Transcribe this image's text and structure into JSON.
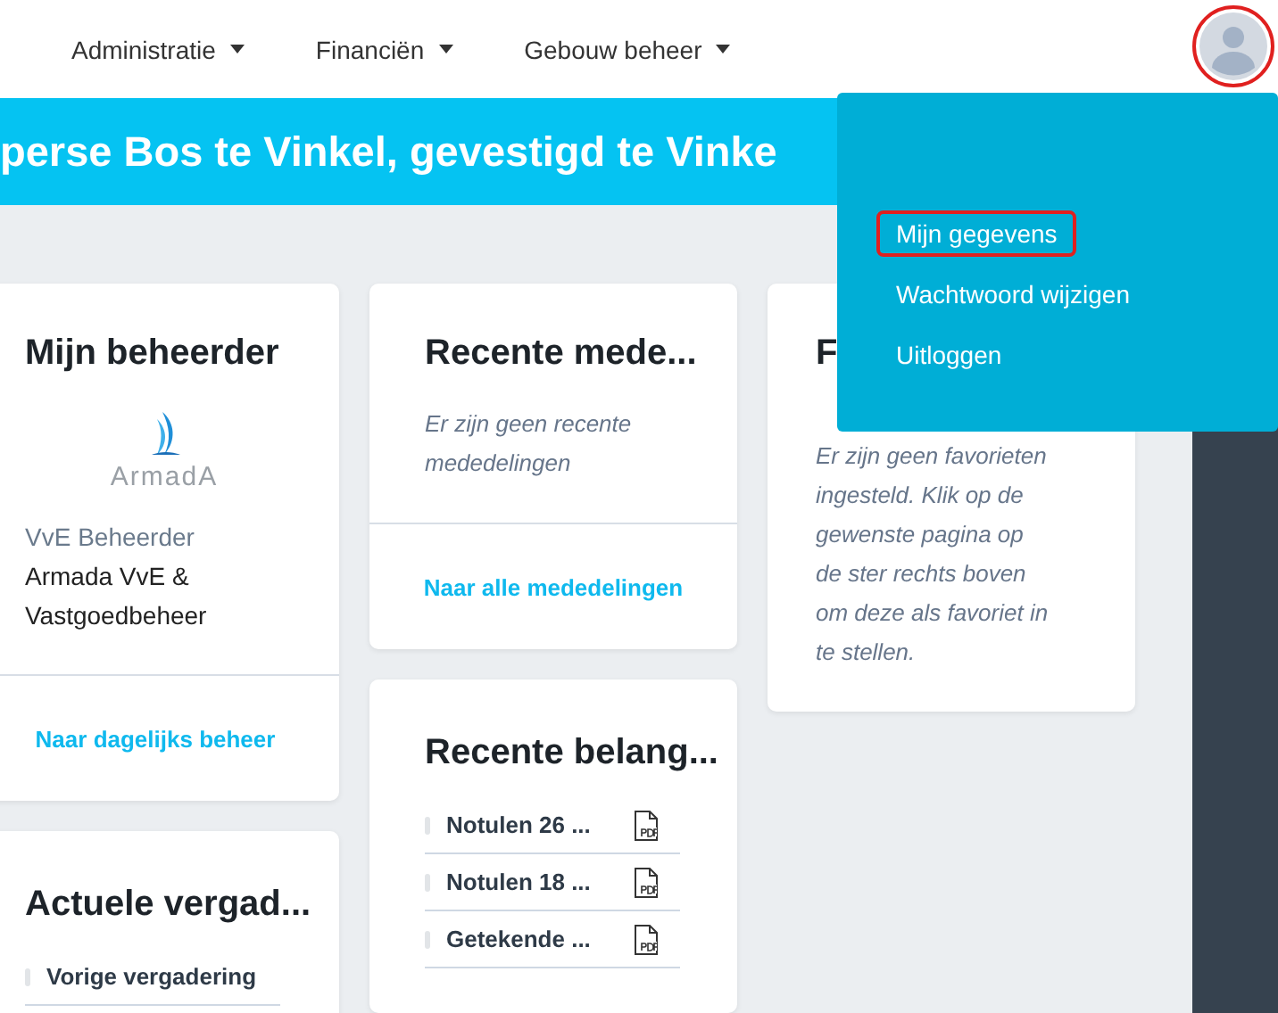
{
  "nav": {
    "items": [
      {
        "label": "Administratie"
      },
      {
        "label": "Financiën"
      },
      {
        "label": "Gebouw beheer"
      }
    ],
    "avatar": {
      "highlighted": true
    }
  },
  "banner": {
    "title": "perse Bos te Vinkel, gevestigd te Vinke"
  },
  "user_menu": {
    "items": [
      {
        "label": "Mijn gegevens",
        "highlighted": true
      },
      {
        "label": "Wachtwoord wijzigen",
        "highlighted": false
      },
      {
        "label": "Uitloggen",
        "highlighted": false
      }
    ]
  },
  "columns": [
    [
      {
        "kind": "manager",
        "title": "Mijn beheerder",
        "logo_text": "ArmadA",
        "role": "VvE Beheerder",
        "name": "Armada VvE & Vastgoedbeheer",
        "link": "Naar dagelijks beheer"
      },
      {
        "kind": "list",
        "title": "Actuele vergad...",
        "items": [
          {
            "label": "Vorige vergadering",
            "pdf": false
          }
        ]
      }
    ],
    [
      {
        "kind": "note",
        "title": "Recente mede...",
        "text": "Er zijn geen recente mededelingen",
        "link": "Naar alle mededelingen"
      },
      {
        "kind": "list",
        "title": "Recente belang...",
        "items": [
          {
            "label": "Notulen 26 ...",
            "pdf": true
          },
          {
            "label": "Notulen 18 ...",
            "pdf": true
          },
          {
            "label": "Getekende ...",
            "pdf": true
          }
        ]
      }
    ],
    [
      {
        "kind": "note",
        "title": "F",
        "text": "Er zijn geen favorieten ingesteld. Klik op de gewenste pagina op de ster rechts boven om deze als favoriet in te stellen."
      }
    ]
  ]
}
